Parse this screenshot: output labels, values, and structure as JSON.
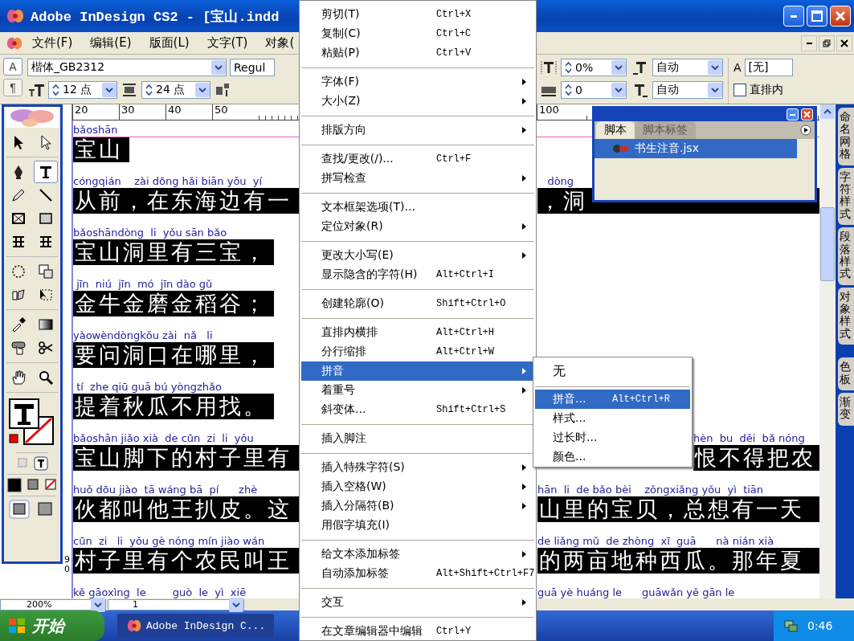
{
  "window": {
    "title": "Adobe InDesign CS2 - [宝山.indd"
  },
  "menu_bar": [
    "文件(F)",
    "编辑(E)",
    "版面(L)",
    "文字(T)",
    "对象("
  ],
  "control_panel": {
    "mode_buttons": [
      {
        "label": "A",
        "selected": true
      },
      {
        "label": "¶",
        "selected": false
      }
    ],
    "font_family": "楷体_GB2312",
    "font_style": "Regul",
    "font_size": "12 点",
    "leading": "24 点",
    "baseline_scale": "0%",
    "tracking": "0",
    "auto_top": "自动",
    "auto_bottom": "自动",
    "style_label": "A",
    "char_style": "[无]",
    "checkbox": {
      "label": "直排内",
      "checked": false
    }
  },
  "ruler": {
    "left_marks": [
      "20",
      "30",
      "40",
      "50"
    ],
    "right_marks": [
      "100"
    ],
    "vertical_mark": "90"
  },
  "toolbox": {
    "tools": [
      {
        "kind": "select",
        "selected": false
      },
      {
        "kind": "direct",
        "selected": false
      },
      {
        "kind": "pen",
        "selected": false
      },
      {
        "kind": "type",
        "selected": true
      },
      {
        "kind": "pencil",
        "selected": false
      },
      {
        "kind": "line",
        "selected": false
      },
      {
        "kind": "frame",
        "selected": false
      },
      {
        "kind": "rect",
        "selected": false
      },
      {
        "kind": "grid",
        "selected": false
      },
      {
        "kind": "grid",
        "selected": false
      },
      {
        "kind": "rotate",
        "selected": false
      },
      {
        "kind": "scale",
        "selected": false
      },
      {
        "kind": "shear",
        "selected": false
      },
      {
        "kind": "transform",
        "selected": false
      },
      {
        "kind": "eyedropper",
        "selected": false
      },
      {
        "kind": "gradient",
        "selected": false
      },
      {
        "kind": "button",
        "selected": false
      },
      {
        "kind": "scissors",
        "selected": false
      },
      {
        "kind": "hand",
        "selected": false
      },
      {
        "kind": "zoom",
        "selected": false
      }
    ]
  },
  "document": {
    "lines": [
      {
        "pinyin": "bǎoshān",
        "hanzi": "宝山"
      },
      {
        "pinyin": "cóngqián    zài dōng hǎi biān yǒu  yí",
        "hanzi": "从前，在东海边有一",
        "right_pinyin": "   dòng",
        "right_hanzi": "，洞"
      },
      {
        "pinyin": "bǎoshāndòng  li  yǒu sān bǎo",
        "hanzi": "宝山洞里有三宝，"
      },
      {
        "pinyin": " jīn  niú  jīn  mó  jīn dào gǔ",
        "hanzi": "金牛金磨金稻谷；"
      },
      {
        "pinyin": "yàowèndòngkǒu zài  nǎ   li",
        "hanzi": "要问洞口在哪里，"
      },
      {
        "pinyin": " tí  zhe qiū guā bú yòngzhǎo",
        "hanzi": "提着秋瓜不用找。"
      },
      {
        "pinyin": "bǎoshān jiǎo xià  de cūn  zi  li  yǒu",
        "hanzi": "宝山脚下的村子里有",
        "right_pinyin": "hèn  bu  děi  bǎ nóng",
        "right_hanzi": "恨不得把农"
      },
      {
        "pinyin": "huǒ dōu jiào  tā wáng bā  pí      zhè",
        "hanzi": "伙都叫他王扒皮。这",
        "right_pinyin": "hān  li  de bǎo bèi    zǒngxiǎng yǒu  yì  tiān",
        "right_hanzi": "山里的宝贝，总想有一天"
      },
      {
        "pinyin": "cūn  zi   li  yǒu gè nóng mín jiào wán",
        "hanzi": "村子里有个农民叫王",
        "right_pinyin": "de liǎng mǔ  de zhòng  xī  guā      nà nián xià",
        "right_hanzi": "的两亩地种西瓜。那年夏"
      },
      {
        "pinyin": "kě gāoxìng  le        guò  le  yì  xiē",
        "right_pinyin": "guā yè huáng le      guāwǎn yě gān le"
      }
    ]
  },
  "edit_menu": {
    "items": [
      {
        "kind": "item",
        "label": "剪切(T)",
        "shortcut": "Ctrl+X",
        "submenu": false,
        "selected": false
      },
      {
        "kind": "item",
        "label": "复制(C)",
        "shortcut": "Ctrl+C",
        "submenu": false,
        "selected": false
      },
      {
        "kind": "item",
        "label": "粘贴(P)",
        "shortcut": "Ctrl+V",
        "submenu": false,
        "selected": false
      },
      {
        "kind": "separator"
      },
      {
        "kind": "item",
        "label": "字体(F)",
        "submenu": true,
        "selected": false
      },
      {
        "kind": "item",
        "label": "大小(Z)",
        "submenu": true,
        "selected": false
      },
      {
        "kind": "separator"
      },
      {
        "kind": "item",
        "label": "排版方向",
        "submenu": true,
        "selected": false
      },
      {
        "kind": "separator"
      },
      {
        "kind": "item",
        "label": "查找/更改(/)...",
        "shortcut": "Ctrl+F",
        "submenu": false,
        "selected": false
      },
      {
        "kind": "item",
        "label": "拼写检查",
        "submenu": true,
        "selected": false
      },
      {
        "kind": "separator"
      },
      {
        "kind": "item",
        "label": "文本框架选项(T)...",
        "submenu": false,
        "selected": false
      },
      {
        "kind": "item",
        "label": "定位对象(R)",
        "submenu": true,
        "selected": false
      },
      {
        "kind": "separator"
      },
      {
        "kind": "item",
        "label": "更改大小写(E)",
        "submenu": true,
        "selected": false
      },
      {
        "kind": "item",
        "label": "显示隐含的字符(H)",
        "shortcut": "Alt+Ctrl+I",
        "submenu": false,
        "selected": false
      },
      {
        "kind": "separator"
      },
      {
        "kind": "item",
        "label": "创建轮廓(O)",
        "shortcut": "Shift+Ctrl+O",
        "submenu": false,
        "selected": false
      },
      {
        "kind": "separator"
      },
      {
        "kind": "item",
        "label": "直排内横排",
        "shortcut": "Alt+Ctrl+H",
        "submenu": false,
        "selected": false
      },
      {
        "kind": "item",
        "label": "分行缩排",
        "shortcut": "Alt+Ctrl+W",
        "submenu": false,
        "selected": false
      },
      {
        "kind": "item",
        "label": "拼音",
        "submenu": true,
        "selected": true
      },
      {
        "kind": "item",
        "label": "着重号",
        "submenu": true,
        "selected": false
      },
      {
        "kind": "item",
        "label": "斜变体...",
        "shortcut": "Shift+Ctrl+S",
        "submenu": false,
        "selected": false
      },
      {
        "kind": "separator"
      },
      {
        "kind": "item",
        "label": "插入脚注",
        "submenu": false,
        "selected": false
      },
      {
        "kind": "separator"
      },
      {
        "kind": "item",
        "label": "插入特殊字符(S)",
        "submenu": true,
        "selected": false
      },
      {
        "kind": "item",
        "label": "插入空格(W)",
        "submenu": true,
        "selected": false
      },
      {
        "kind": "item",
        "label": "插入分隔符(B)",
        "submenu": true,
        "selected": false
      },
      {
        "kind": "item",
        "label": "用假字填充(I)",
        "submenu": false,
        "selected": false
      },
      {
        "kind": "separator"
      },
      {
        "kind": "item",
        "label": "给文本添加标签",
        "submenu": true,
        "selected": false
      },
      {
        "kind": "item",
        "label": "自动添加标签",
        "shortcut": "Alt+Shift+Ctrl+F7",
        "submenu": false,
        "selected": false
      },
      {
        "kind": "separator"
      },
      {
        "kind": "item",
        "label": "交互",
        "submenu": true,
        "selected": false
      },
      {
        "kind": "separator"
      },
      {
        "kind": "item",
        "label": "在文章编辑器中编辑",
        "shortcut": "Ctrl+Y",
        "submenu": false,
        "selected": false
      }
    ]
  },
  "pinyin_submenu": {
    "items": [
      {
        "kind": "item",
        "label": "无",
        "selected": false
      },
      {
        "kind": "separator"
      },
      {
        "kind": "item",
        "label": "拼音...",
        "shortcut": "Alt+Ctrl+R",
        "selected": true
      },
      {
        "kind": "item",
        "label": "样式...",
        "selected": false
      },
      {
        "kind": "item",
        "label": "过长时...",
        "selected": false
      },
      {
        "kind": "item",
        "label": "颜色...",
        "selected": false
      }
    ]
  },
  "script_panel": {
    "tabs": [
      {
        "label": "脚本",
        "selected": true
      },
      {
        "label": "脚本标签",
        "selected": false
      }
    ],
    "items": [
      {
        "label": "书生注音.jsx",
        "selected": true
      }
    ]
  },
  "side_panels": {
    "upper": [
      "命名网格",
      "字符样式",
      "段落样式",
      "对象样式"
    ],
    "lower": [
      "色板",
      "渐变"
    ]
  },
  "status_bar": {
    "zoom": "200%",
    "page": "1"
  },
  "taskbar": {
    "start": "开始",
    "tasks": [
      "Adobe InDesign C..."
    ],
    "clock": "0:46"
  }
}
